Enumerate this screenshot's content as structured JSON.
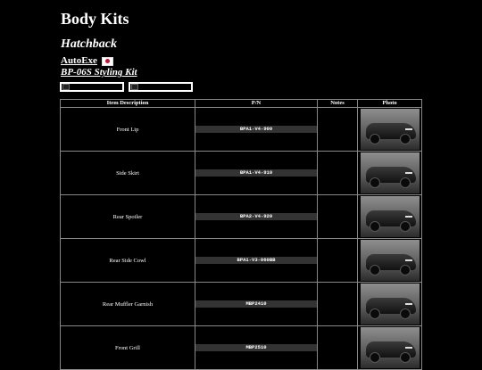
{
  "page": {
    "title": "Body Kits",
    "subtitle": "Hatchback"
  },
  "brand": {
    "name": "AutoExe",
    "flag": "japan-flag"
  },
  "kit": {
    "name": "BP-06S Styling Kit"
  },
  "table": {
    "headers": [
      "Item Description",
      "P/N",
      "Notes",
      "Photo"
    ],
    "rows": [
      {
        "description": "Front Lip",
        "pn": "BPA1-V4-900",
        "notes": ""
      },
      {
        "description": "Side Skirt",
        "pn": "BPA1-V4-910",
        "notes": ""
      },
      {
        "description": "Rear Spoiler",
        "pn": "BPA2-V4-920",
        "notes": ""
      },
      {
        "description": "Rear Side Cowl",
        "pn": "BPA1-V3-060BB",
        "notes": ""
      },
      {
        "description": "Rear Muffler Garnish",
        "pn": "MBP2410",
        "notes": ""
      },
      {
        "description": "Front Grill",
        "pn": "MBP2510",
        "notes": ""
      }
    ]
  },
  "colors": {
    "background": "#000000",
    "text": "#ffffff",
    "pn_badge": "#333333",
    "border": "#888888"
  }
}
